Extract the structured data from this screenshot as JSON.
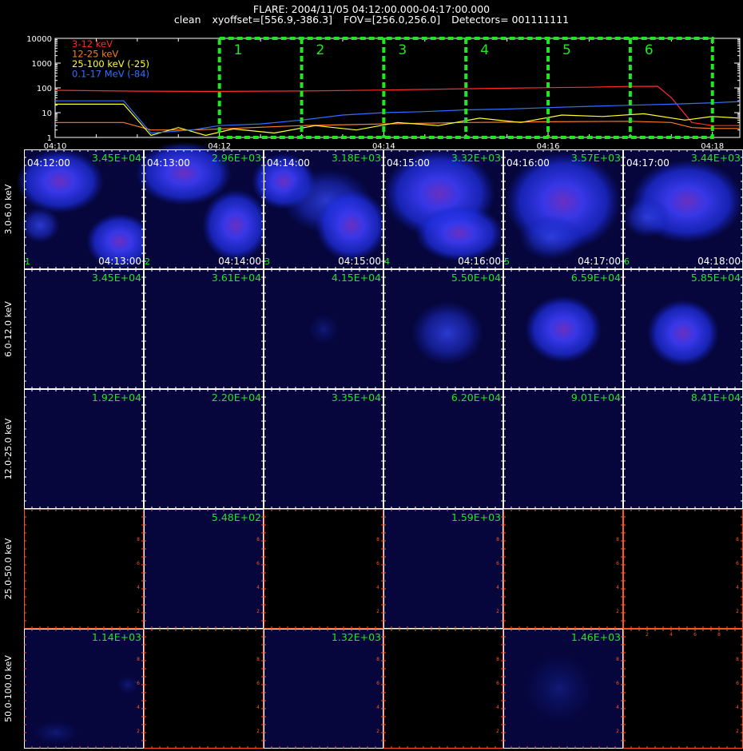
{
  "header": {
    "title": "FLARE: 2004/11/05 04:12:00.000-04:17:00.000",
    "method": "clean",
    "xyoffset": "xyoffset=[556.9,-386.3]",
    "fov": "FOV=[256.0,256.0]",
    "detectors": "Detectors= 001111111"
  },
  "colors": {
    "band_3_12": "#ff2a2a",
    "band_12_25": "#ff7a20",
    "band_25_100": "#ffff30",
    "band_100_17000": "#3070ff",
    "interval_box": "#22e622",
    "grid": "#ffffff",
    "empty_axis": "#ff5522",
    "image_bg": "#06063c"
  },
  "chart_data": [
    {
      "type": "line",
      "title": "",
      "xlabel": "",
      "ylabel": "",
      "xlim": [
        "04:10",
        "04:18:20"
      ],
      "yscale": "log",
      "ylim": [
        1,
        10000
      ],
      "y_ticks": [
        "1",
        "10",
        "100",
        "1000",
        "10000"
      ],
      "x_ticks": [
        "04:10",
        "04:12",
        "04:14",
        "04:16",
        "04:18"
      ],
      "legend_position": "top-left",
      "series": [
        {
          "name": "3-12 keV",
          "color": "#ff2a2a",
          "x": [
            "04:10:00",
            "04:11:00",
            "04:12:00",
            "04:13:00",
            "04:14:00",
            "04:15:00",
            "04:16:00",
            "04:16:30",
            "04:17:00",
            "04:17:20",
            "04:17:30",
            "04:17:45",
            "04:18:00",
            "04:18:20"
          ],
          "y": [
            80,
            74,
            72,
            75,
            82,
            92,
            102,
            106,
            115,
            116,
            40,
            4,
            3,
            3
          ]
        },
        {
          "name": "12-25 keV",
          "color": "#ff7a20",
          "x": [
            "04:10:00",
            "04:10:50",
            "04:11:10",
            "04:11:40",
            "04:12:00",
            "04:13:00",
            "04:14:00",
            "04:15:00",
            "04:16:00",
            "04:17:00",
            "04:17:30",
            "04:17:45",
            "04:18:00",
            "04:18:20"
          ],
          "y": [
            4,
            4,
            2,
            2,
            2.2,
            3,
            3.5,
            4,
            4.3,
            4.5,
            4,
            2.5,
            2.3,
            2.3
          ]
        },
        {
          "name": "25-100 keV (-25)",
          "color": "#ffff30",
          "x": [
            "04:10:00",
            "04:10:50",
            "04:11:10",
            "04:11:30",
            "04:11:50",
            "04:12:10",
            "04:12:40",
            "04:13:10",
            "04:13:40",
            "04:14:10",
            "04:14:40",
            "04:15:10",
            "04:15:40",
            "04:16:10",
            "04:16:40",
            "04:17:10",
            "04:17:40",
            "04:18:00",
            "04:18:20"
          ],
          "y": [
            22,
            22,
            1.2,
            2.5,
            1.2,
            2.2,
            1.5,
            3,
            2,
            4,
            3,
            6,
            4,
            8,
            7,
            9,
            5,
            7,
            6
          ]
        },
        {
          "name": "0.1-17 MeV (-84)",
          "color": "#3070ff",
          "x": [
            "04:10:00",
            "04:10:50",
            "04:11:10",
            "04:11:40",
            "04:12:00",
            "04:12:30",
            "04:13:00",
            "04:13:30",
            "04:14:00",
            "04:14:30",
            "04:15:00",
            "04:15:30",
            "04:16:00",
            "04:16:30",
            "04:17:00",
            "04:17:30",
            "04:18:00",
            "04:18:20"
          ],
          "y": [
            30,
            30,
            1.5,
            2,
            3,
            3.5,
            5,
            8,
            10,
            11,
            13,
            14,
            16,
            18,
            20,
            22,
            25,
            28
          ]
        }
      ],
      "annotations": {
        "interval_labels": [
          "1",
          "2",
          "3",
          "4",
          "5",
          "6"
        ],
        "interval_edges": [
          "04:12:00",
          "04:13:00",
          "04:14:00",
          "04:15:00",
          "04:16:00",
          "04:17:00",
          "04:18:00"
        ]
      }
    },
    {
      "type": "heatmap",
      "band_labels": [
        "3.0-6.0 keV",
        "6.0-12.0 keV",
        "12.0-25.0 keV",
        "25.0-50.0 keV",
        "50.0-100.0 keV"
      ],
      "intervals": [
        {
          "index": "1",
          "start": "04:12:00",
          "end": "04:13:00"
        },
        {
          "index": "2",
          "start": "04:13:00",
          "end": "04:14:00"
        },
        {
          "index": "3",
          "start": "04:14:00",
          "end": "04:15:00"
        },
        {
          "index": "4",
          "start": "04:15:00",
          "end": "04:16:00"
        },
        {
          "index": "5",
          "start": "04:16:00",
          "end": "04:17:00"
        },
        {
          "index": "6",
          "start": "04:17:00",
          "end": "04:18:00"
        }
      ],
      "peak_labels": [
        [
          "3.45E+04",
          "2.96E+03",
          "3.18E+03",
          "3.32E+03",
          "3.57E+03",
          "3.44E+03"
        ],
        [
          "3.45E+04",
          "3.61E+04",
          "4.15E+04",
          "5.50E+04",
          "6.59E+04",
          "5.85E+04"
        ],
        [
          "1.92E+04",
          "2.20E+04",
          "3.35E+04",
          "6.20E+04",
          "9.01E+04",
          "8.41E+04"
        ],
        [
          "",
          "5.48E+02",
          "",
          "1.59E+03",
          "",
          ""
        ],
        [
          "1.14E+03",
          "",
          "1.32E+03",
          "",
          "1.46E+03",
          ""
        ]
      ],
      "empty_axis_ticks": [
        "2",
        "4",
        "6",
        "8"
      ]
    }
  ]
}
